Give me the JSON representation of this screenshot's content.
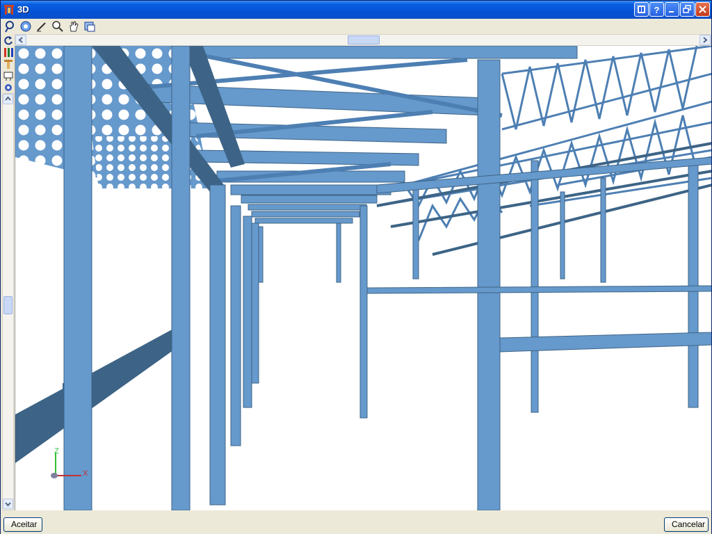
{
  "window": {
    "title": "3D"
  },
  "toolbar": {
    "tools": [
      {
        "name": "rotate-view-icon"
      },
      {
        "name": "orbit-icon"
      },
      {
        "name": "pen-edit-icon"
      },
      {
        "name": "zoom-icon"
      },
      {
        "name": "pan-hand-icon"
      },
      {
        "name": "window-view-icon"
      }
    ]
  },
  "side_tools": [
    {
      "name": "refresh-icon"
    },
    {
      "name": "columns-icon"
    },
    {
      "name": "beam-icon"
    },
    {
      "name": "section-icon"
    },
    {
      "name": "settings-icon"
    }
  ],
  "axes": {
    "z": "Z",
    "x": "X"
  },
  "buttons": {
    "accept": "Aceitar",
    "cancel": "Cancelar"
  },
  "colors": {
    "steel": "#6699cc",
    "steel_dark": "#3d6486",
    "titlebar": "#0553d6"
  }
}
